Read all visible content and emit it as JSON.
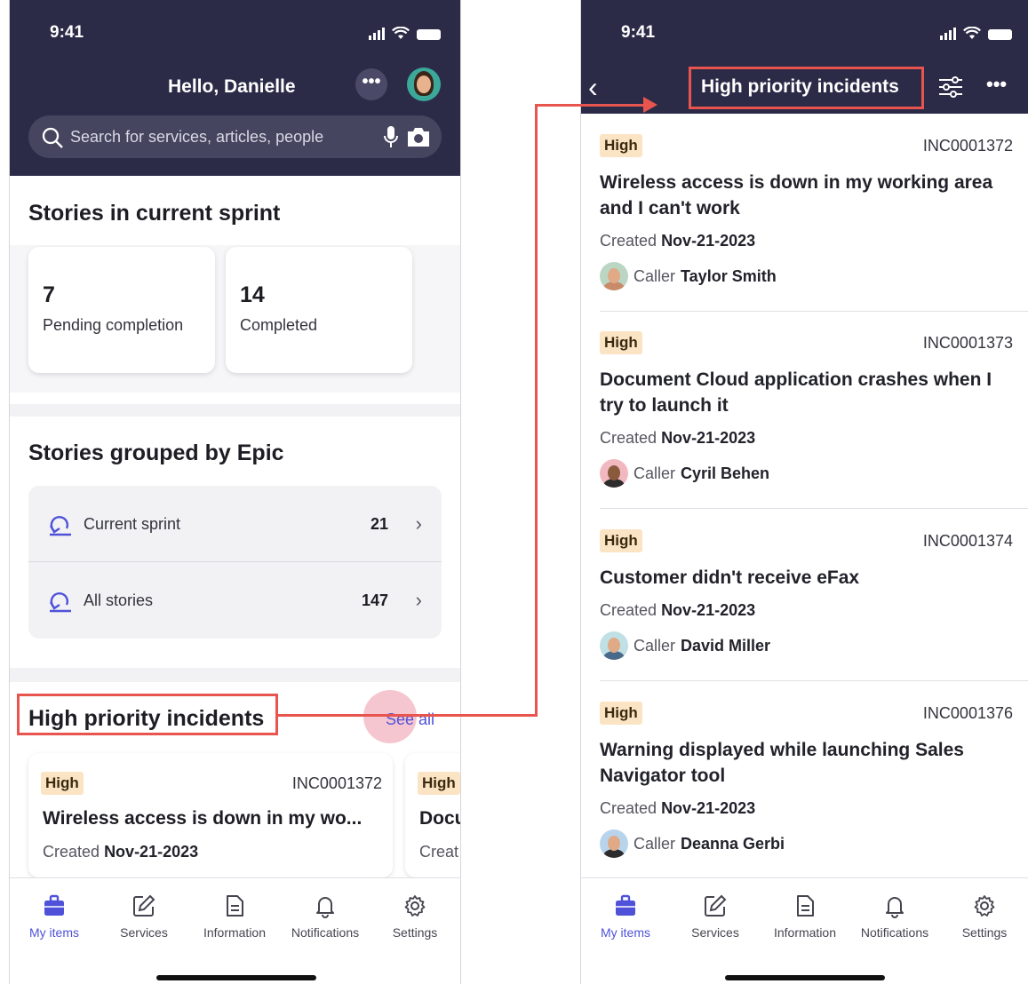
{
  "left": {
    "status_time": "9:41",
    "greeting": "Hello, Danielle",
    "more_label": "•••",
    "search_placeholder": "Search for services, articles, people",
    "sprint": {
      "title": "Stories in current sprint",
      "cards": [
        {
          "value": "7",
          "label": "Pending completion"
        },
        {
          "value": "14",
          "label": "Completed"
        }
      ]
    },
    "epic": {
      "title": "Stories grouped by Epic",
      "rows": [
        {
          "label": "Current sprint",
          "count": "21"
        },
        {
          "label": "All stories",
          "count": "147"
        }
      ]
    },
    "incidents": {
      "title": "High priority incidents",
      "see_all": "See all",
      "cards": [
        {
          "priority": "High",
          "number": "INC0001372",
          "title": "Wireless access is down in my wo...",
          "created_label": "Created",
          "created_date": "Nov-21-2023"
        },
        {
          "priority": "High",
          "title_partial": "Docu",
          "created_partial": "Creat"
        }
      ]
    }
  },
  "right": {
    "status_time": "9:41",
    "title": "High priority incidents",
    "more_label": "•••",
    "incidents": [
      {
        "priority": "High",
        "number": "INC0001372",
        "title": "Wireless access is down in my working area and I can't work",
        "created_label": "Created",
        "created_date": "Nov-21-2023",
        "caller_label": "Caller",
        "caller_name": "Taylor Smith"
      },
      {
        "priority": "High",
        "number": "INC0001373",
        "title": "Document Cloud application crashes when I try to launch it",
        "created_label": "Created",
        "created_date": "Nov-21-2023",
        "caller_label": "Caller",
        "caller_name": "Cyril Behen"
      },
      {
        "priority": "High",
        "number": "INC0001374",
        "title": "Customer didn't receive eFax",
        "created_label": "Created",
        "created_date": "Nov-21-2023",
        "caller_label": "Caller",
        "caller_name": "David Miller"
      },
      {
        "priority": "High",
        "number": "INC0001376",
        "title": "Warning displayed while launching Sales Navigator tool",
        "created_label": "Created",
        "created_date": "Nov-21-2023",
        "caller_label": "Caller",
        "caller_name": "Deanna Gerbi"
      }
    ]
  },
  "tabs": [
    {
      "label": "My items",
      "icon": "briefcase-icon",
      "active": true
    },
    {
      "label": "Services",
      "icon": "pencil-square-icon"
    },
    {
      "label": "Information",
      "icon": "document-icon"
    },
    {
      "label": "Notifications",
      "icon": "bell-icon"
    },
    {
      "label": "Settings",
      "icon": "gear-icon"
    }
  ],
  "colors": {
    "header_bg": "#2b2b48",
    "accent": "#4f52d9",
    "highlight": "#e8554e",
    "badge_bg": "#fbe4c4"
  }
}
